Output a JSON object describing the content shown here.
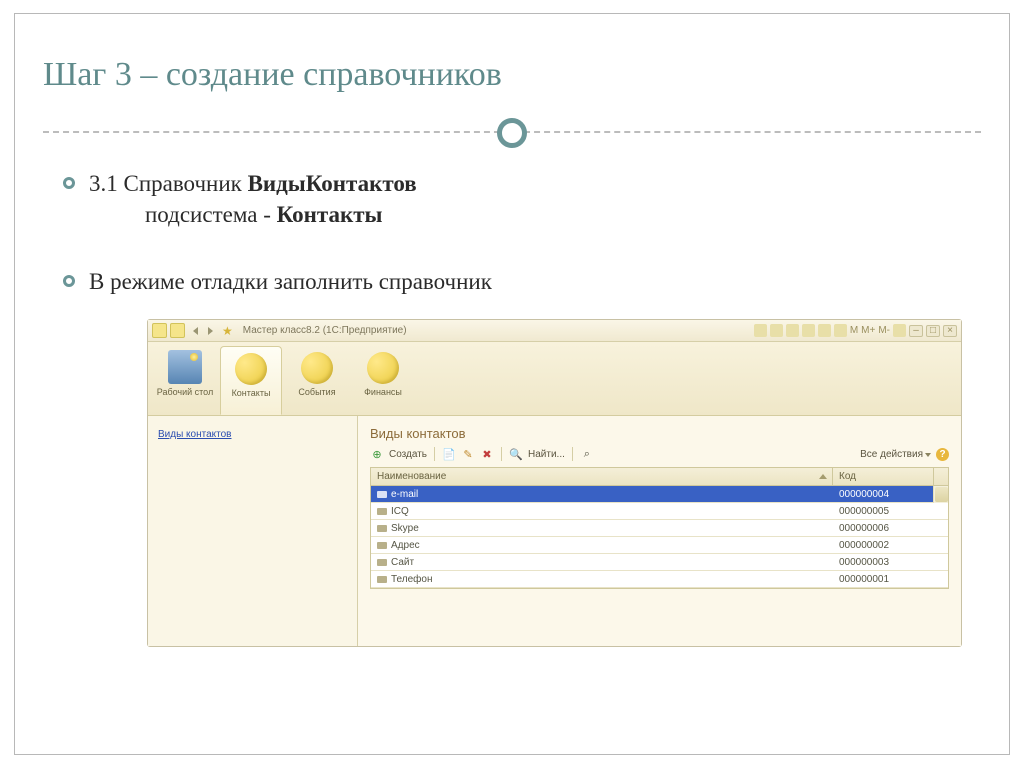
{
  "slide": {
    "title": "Шаг 3 – создание справочников",
    "bullet1_prefix": "3.1 Справочник  ",
    "bullet1_bold": "ВидыКонтактов",
    "bullet1_sub_prefix": "подсистема -  ",
    "bullet1_sub_bold": "Контакты",
    "bullet2": "В режиме отладки заполнить  справочник"
  },
  "app": {
    "window_title": "Мастер класс8.2  (1С:Предприятие)",
    "toolbar_right": {
      "m1": "М",
      "m2": "М+",
      "m3": "М-"
    },
    "tabs": [
      {
        "label": "Рабочий\nстол"
      },
      {
        "label": "Контакты"
      },
      {
        "label": "События"
      },
      {
        "label": "Финансы"
      }
    ],
    "sidebar_link": "Виды контактов",
    "panel_title": "Виды контактов",
    "toolbar": {
      "create": "Создать",
      "find": "Найти...",
      "all_actions": "Все действия"
    },
    "columns": {
      "name": "Наименование",
      "code": "Код"
    },
    "rows": [
      {
        "name": "e-mail",
        "code": "000000004"
      },
      {
        "name": "ICQ",
        "code": "000000005"
      },
      {
        "name": "Skype",
        "code": "000000006"
      },
      {
        "name": "Адрес",
        "code": "000000002"
      },
      {
        "name": "Сайт",
        "code": "000000003"
      },
      {
        "name": "Телефон",
        "code": "000000001"
      }
    ]
  }
}
